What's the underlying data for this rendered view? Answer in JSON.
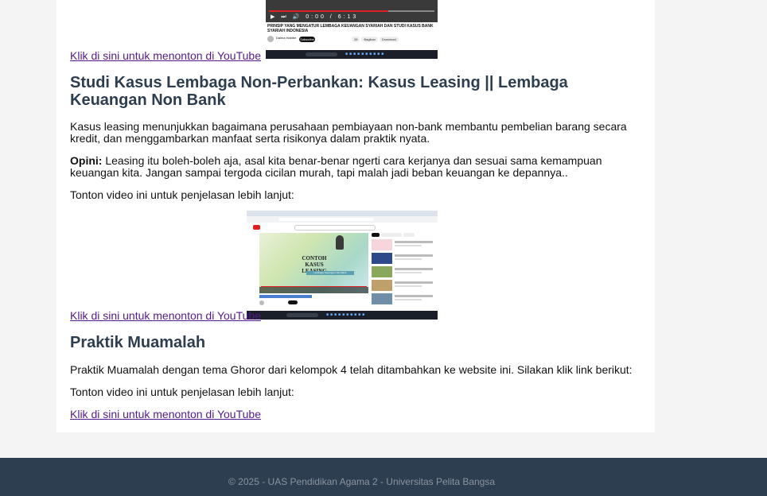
{
  "section_prev": {
    "link_text": "Klik di sini untuk menonton di YouTube",
    "thumbnail": {
      "video_title": "PRINSIP YANG MENGATUR LEMBAGA KEUANGAN SYARIAH DAN STUDI KASUS BANK SYARIAH INDONESIA",
      "channel": "Dalma Habibe",
      "subscribe_label": "Subscribe",
      "actions": [
        "28",
        "Bagikan",
        "Download"
      ],
      "time": "0:00 / 6:13"
    }
  },
  "section_leasing": {
    "heading": "Studi Kasus Lembaga Non-Perbankan: Kasus Leasing || Lembaga Keuangan Non Bank",
    "paragraph": "Kasus leasing menunjukkan bagaimana perusahaan pembiayaan non-bank membantu pembelian barang secara kredit, dan menggambarkan manfaat serta risikonya dalam praktik nyata.",
    "opinion_label": "Opini:",
    "opinion_text": " Leasing itu boleh-boleh aja, asal kita benar-benar ngerti cara kerjanya dan sesuai sama kemampuan keuangan kita. Jangan sampai tergoda cicilan murah, tapi malah jadi beban keuangan ke depannya..",
    "watch_text": "Tonton video ini untuk penjelasan lebih lanjut:",
    "thumbnail": {
      "video_title": "CONTOH KASUS LEASING",
      "video_subtitle": "Lembaga Keuangan Non Bank"
    },
    "link_text": "Klik di sini untuk menonton di YouTube"
  },
  "section_muamalah": {
    "heading": "Praktik Muamalah",
    "paragraph": "Praktik Muamalah dengan tema Ghoror dari kelompok 4 telah ditambahkan ke website ini. Silakan klik link berikut:",
    "watch_text": "Tonton video ini untuk penjelasan lebih lanjut:",
    "link_text": "Klik di sini untuk menonton di YouTube"
  },
  "footer": {
    "text": "© 2025 - UAS Pendidikan Agama 2 - Universitas Pelita Bangsa"
  },
  "colors": {
    "heading": "#2c3e50",
    "link_visited": "#551a8b",
    "footer_bg": "#2c3e50",
    "page_bg": "#f4f4f4"
  }
}
